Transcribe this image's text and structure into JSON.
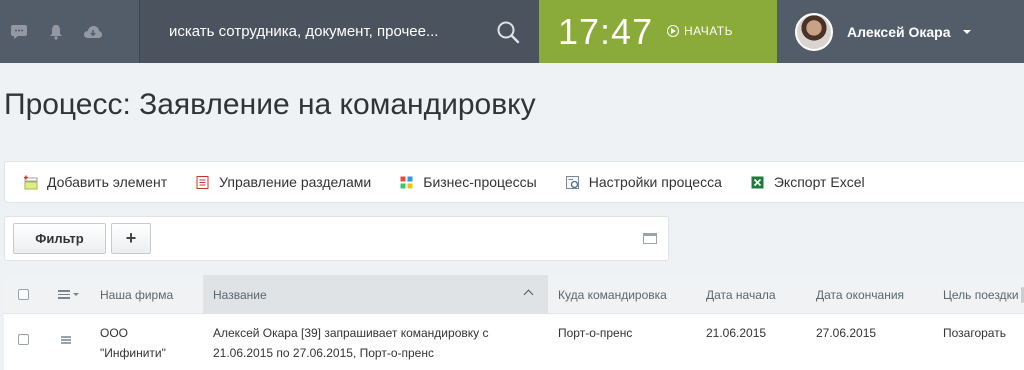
{
  "header": {
    "icons": [
      "chat-icon",
      "bell-icon",
      "cloud-icon"
    ],
    "search_placeholder": "искать сотрудника, документ, прочее...",
    "time": "17:47",
    "start_label": "НАЧАТЬ",
    "user_name": "Алексей Окара",
    "colors": {
      "header_bg": "#535c69",
      "timer_bg": "#8aaa39"
    }
  },
  "page": {
    "title": "Процесс: Заявление на командировку"
  },
  "toolbar": {
    "items": [
      {
        "label": "Добавить элемент",
        "icon": "add-element-icon"
      },
      {
        "label": "Управление разделами",
        "icon": "sections-icon"
      },
      {
        "label": "Бизнес-процессы",
        "icon": "bizproc-icon"
      },
      {
        "label": "Настройки процесса",
        "icon": "settings-icon"
      },
      {
        "label": "Экспорт Excel",
        "icon": "excel-icon"
      }
    ]
  },
  "filter": {
    "button_label": "Фильтр",
    "add_label": "+"
  },
  "table": {
    "columns": [
      "Наша фирма",
      "Название",
      "Куда командировка",
      "Дата начала",
      "Дата окончания",
      "Цель поездки"
    ],
    "sorted_column": "Название",
    "rows": [
      {
        "company_line1": "ООО",
        "company_line2": "\"Инфинити\"",
        "name_line1": "Алексей Окара [39] запрашивает командировку с",
        "name_line2": "21.06.2015 по 27.06.2015, Порт-о-пренс",
        "destination": "Порт-о-пренс",
        "date_start": "21.06.2015",
        "date_end": "27.06.2015",
        "purpose": "Позагорать"
      }
    ]
  }
}
